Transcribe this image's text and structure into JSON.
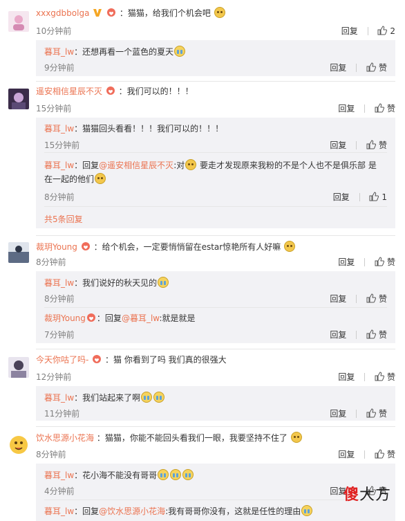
{
  "comments": [
    {
      "user": "xxxgdbbolga",
      "text": "：猫猫，给我们个机会吧",
      "time": "10分钟前",
      "reply": "回复",
      "likes": "2",
      "replies": [
        {
          "user": "暮耳_lw",
          "text": "：还想再看一个蓝色的夏天",
          "time": "9分钟前",
          "reply": "回复",
          "like": "赞"
        }
      ]
    },
    {
      "user": "遥安相信星辰不灭",
      "text": "：我们可以的！！！",
      "time": "15分钟前",
      "reply": "回复",
      "likes": "赞",
      "replies": [
        {
          "user": "暮耳_lw",
          "text": "：猫猫回头看看！！！我们可以的！！！",
          "time": "15分钟前",
          "reply": "回复",
          "like": "赞"
        },
        {
          "user": "暮耳_lw",
          "text_pre": "：回复",
          "mention": "@遥安相信星辰不灭",
          "text": ":对",
          "text2": " 要走才发现原来我粉的不是个人也不是俱乐部 是",
          "text3": "在一起的他们",
          "time": "8分钟前",
          "reply": "回复",
          "like": "1"
        }
      ],
      "more": "共5条回复"
    },
    {
      "user": "裁玥Young",
      "text": "：给个机会，一定要悄悄留在estar惊艳所有人好嘛",
      "time": "8分钟前",
      "reply": "回复",
      "likes": "赞",
      "replies": [
        {
          "user": "暮耳_lw",
          "text": "：我们说好的秋天见的",
          "time": "8分钟前",
          "reply": "回复",
          "like": "赞"
        },
        {
          "user": "裁玥Young",
          "text_pre": "：回复",
          "mention": "@暮耳_lw",
          "text": ":就是就是",
          "time": "7分钟前",
          "reply": "回复",
          "like": "赞"
        }
      ]
    },
    {
      "user": "今天你咕了吗-",
      "text": "：猫 你看到了吗 我们真的很强大",
      "time": "12分钟前",
      "reply": "回复",
      "likes": "赞",
      "replies": [
        {
          "user": "暮耳_lw",
          "text": "：我们站起来了啊",
          "time": "11分钟前",
          "reply": "回复",
          "like": "赞"
        }
      ]
    },
    {
      "user": "饮水思源小花海",
      "text": "：猫猫，你能不能回头看我们一眼，我要坚持不住了",
      "time": "8分钟前",
      "reply": "回复",
      "likes": "赞",
      "replies": [
        {
          "user": "暮耳_lw",
          "text": "：花小海不能没有哥哥",
          "time": "4分钟前",
          "reply": "回复",
          "like": "赞"
        },
        {
          "user": "暮耳_lw",
          "text_pre": "：回复",
          "mention": "@饮水思源小花海",
          "text": ":我有哥哥你没有，这就是任性的理由",
          "time": "",
          "reply": "",
          "like": ""
        }
      ]
    }
  ],
  "watermark": {
    "red": "傻",
    "rest": "大方"
  },
  "colors": {
    "username": "#eb7350",
    "reply_bg": "#f2f2f5",
    "time": "#808080"
  }
}
